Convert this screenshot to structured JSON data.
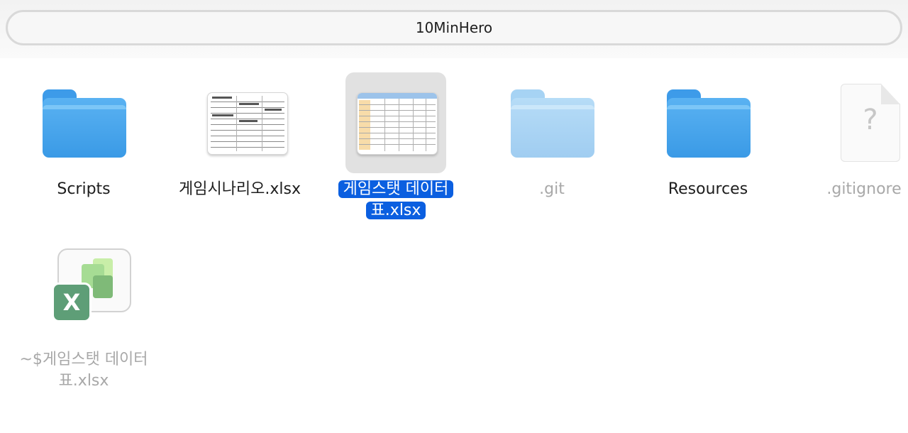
{
  "window": {
    "path_title": "10MinHero"
  },
  "items": [
    {
      "label": "Scripts",
      "type": "folder",
      "icon": "folder-icon"
    },
    {
      "label": "게임시나리오.xlsx",
      "type": "spreadsheet",
      "icon": "spreadsheet-preview-icon"
    },
    {
      "label_line1": "게임스탯 데이터",
      "label_line2": "표.xlsx",
      "type": "spreadsheet",
      "icon": "spreadsheet-preview-icon",
      "selected": true
    },
    {
      "label": ".git",
      "type": "folder",
      "icon": "folder-icon",
      "hidden": true
    },
    {
      "label": "Resources",
      "type": "folder",
      "icon": "folder-icon"
    },
    {
      "label": ".gitignore",
      "type": "file",
      "icon": "generic-file-icon",
      "hidden": true
    },
    {
      "label_line1": "~$게임스탯 데이터",
      "label_line2": "표.xlsx",
      "type": "excel",
      "icon": "excel-icon",
      "hidden": true
    }
  ],
  "icon_glyphs": {
    "generic_file": "?",
    "excel_badge": "X"
  },
  "colors": {
    "selection": "#0b5fe0",
    "folder_blue": "#3d9be9",
    "folder_hidden": "#a6d3f4",
    "hidden_text": "#a8a8a8"
  }
}
